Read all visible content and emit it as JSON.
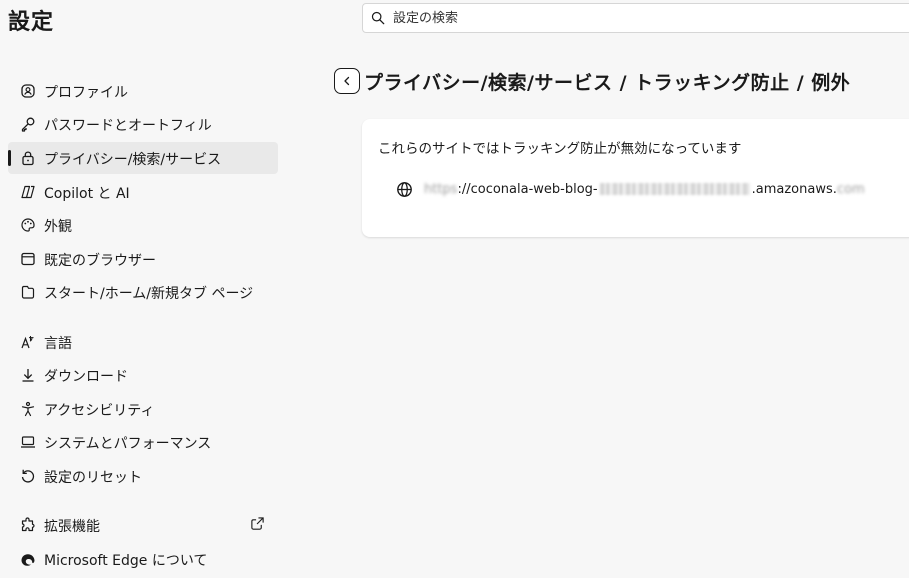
{
  "app": {
    "title": "設定"
  },
  "search": {
    "placeholder": "設定の検索"
  },
  "sidebar": {
    "items": [
      {
        "label": "プロファイル",
        "icon": "profile-icon"
      },
      {
        "label": "パスワードとオートフィル",
        "icon": "key-icon"
      },
      {
        "label": "プライバシー/検索/サービス",
        "icon": "lock-icon",
        "active": true
      },
      {
        "label": "Copilot と AI",
        "icon": "copilot-icon"
      },
      {
        "label": "外観",
        "icon": "palette-icon"
      },
      {
        "label": "既定のブラウザー",
        "icon": "browser-icon"
      },
      {
        "label": "スタート/ホーム/新規タブ ページ",
        "icon": "home-tab-icon"
      },
      {
        "label": "言語",
        "icon": "language-icon"
      },
      {
        "label": "ダウンロード",
        "icon": "download-icon"
      },
      {
        "label": "アクセシビリティ",
        "icon": "accessibility-icon"
      },
      {
        "label": "システムとパフォーマンス",
        "icon": "laptop-icon"
      },
      {
        "label": "設定のリセット",
        "icon": "reset-icon"
      },
      {
        "label": "拡張機能",
        "icon": "extension-icon"
      },
      {
        "label": "Microsoft Edge について",
        "icon": "edge-logo-icon"
      }
    ]
  },
  "main": {
    "title": "プライバシー/検索/サービス / トラッキング防止 / 例外",
    "description": "これらのサイトではトラッキング防止が無効になっています",
    "site": {
      "prefix": "https",
      "middle": "://coconala-web-blog-",
      "suffix": ".amazonaws.",
      "tail": "com"
    }
  },
  "colors": {
    "background": "#f7f7f7",
    "card": "#ffffff",
    "active_item": "#e9e9e9",
    "text": "#1a1a1a"
  }
}
